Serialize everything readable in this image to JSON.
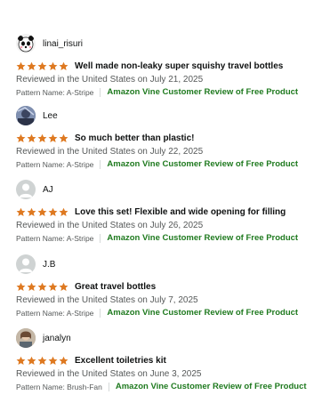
{
  "reviews": [
    {
      "username": "linai_risuri",
      "avatar_icon": "panda-avatar-icon",
      "rating": 5,
      "title": "Well made non-leaky super squishy travel bottles",
      "date": "Reviewed in the United States on July 21, 2025",
      "pattern": "Pattern Name: A-Stripe",
      "vine_label": "Amazon Vine Customer Review of Free Product"
    },
    {
      "username": "Lee",
      "avatar_icon": "photo-avatar-icon",
      "rating": 5,
      "title": "So much better than plastic!",
      "date": "Reviewed in the United States on July 22, 2025",
      "pattern": "Pattern Name: A-Stripe",
      "vine_label": "Amazon Vine Customer Review of Free Product"
    },
    {
      "username": "AJ",
      "avatar_icon": "default-user-avatar-icon",
      "rating": 5,
      "title": "Love this set! Flexible and wide opening for filling",
      "date": "Reviewed in the United States on July 26, 2025",
      "pattern": "Pattern Name: A-Stripe",
      "vine_label": "Amazon Vine Customer Review of Free Product"
    },
    {
      "username": "J.B",
      "avatar_icon": "default-user-avatar-icon",
      "rating": 5,
      "title": "Great travel bottles",
      "date": "Reviewed in the United States on July 7, 2025",
      "pattern": "Pattern Name: A-Stripe",
      "vine_label": "Amazon Vine Customer Review of Free Product"
    },
    {
      "username": "janalyn",
      "avatar_icon": "photo-avatar-icon",
      "rating": 5,
      "title": "Excellent toiletries kit",
      "date": "Reviewed in the United States on June 3, 2025",
      "pattern": "Pattern Name: Brush-Fan",
      "vine_label": "Amazon Vine Customer Review of Free Product"
    }
  ],
  "colors": {
    "star": "#de7921",
    "vine": "#1f7a1f",
    "secondary_text": "#565959",
    "separator": "#d5d9d9"
  }
}
